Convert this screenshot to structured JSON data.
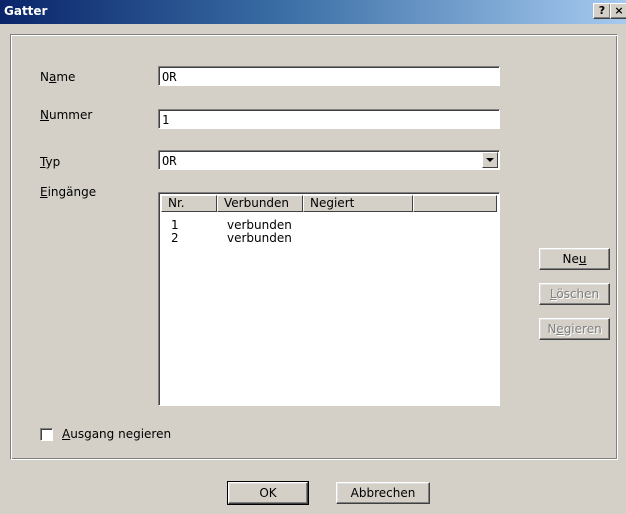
{
  "window": {
    "title": "Gatter",
    "help_label": "?",
    "close_label": "×"
  },
  "form": {
    "name_label_pre": "N",
    "name_label_ul": "a",
    "name_label_post": "me",
    "name_value": "OR",
    "nummer_label_ul": "N",
    "nummer_label_post": "ummer",
    "nummer_value": "1",
    "typ_label_ul": "T",
    "typ_label_post": "yp",
    "typ_value": "OR",
    "eingaenge_label_ul": "E",
    "eingaenge_label_post": "ingänge"
  },
  "inputs_list": {
    "columns": [
      "Nr.",
      "Verbunden",
      "Negiert",
      ""
    ],
    "rows": [
      {
        "nr": "1",
        "verbunden": "verbunden",
        "negiert": ""
      },
      {
        "nr": "2",
        "verbunden": "verbunden",
        "negiert": ""
      }
    ]
  },
  "side_buttons": {
    "neu_pre": "Ne",
    "neu_ul": "u",
    "loeschen_ul": "L",
    "loeschen_post": "öschen",
    "negieren_pre": "N",
    "negieren_ul": "e",
    "negieren_post": "gieren"
  },
  "checkbox": {
    "label_ul": "A",
    "label_post": "usgang negieren",
    "checked": false
  },
  "footer": {
    "ok_label": "OK",
    "cancel_label": "Abbrechen"
  }
}
